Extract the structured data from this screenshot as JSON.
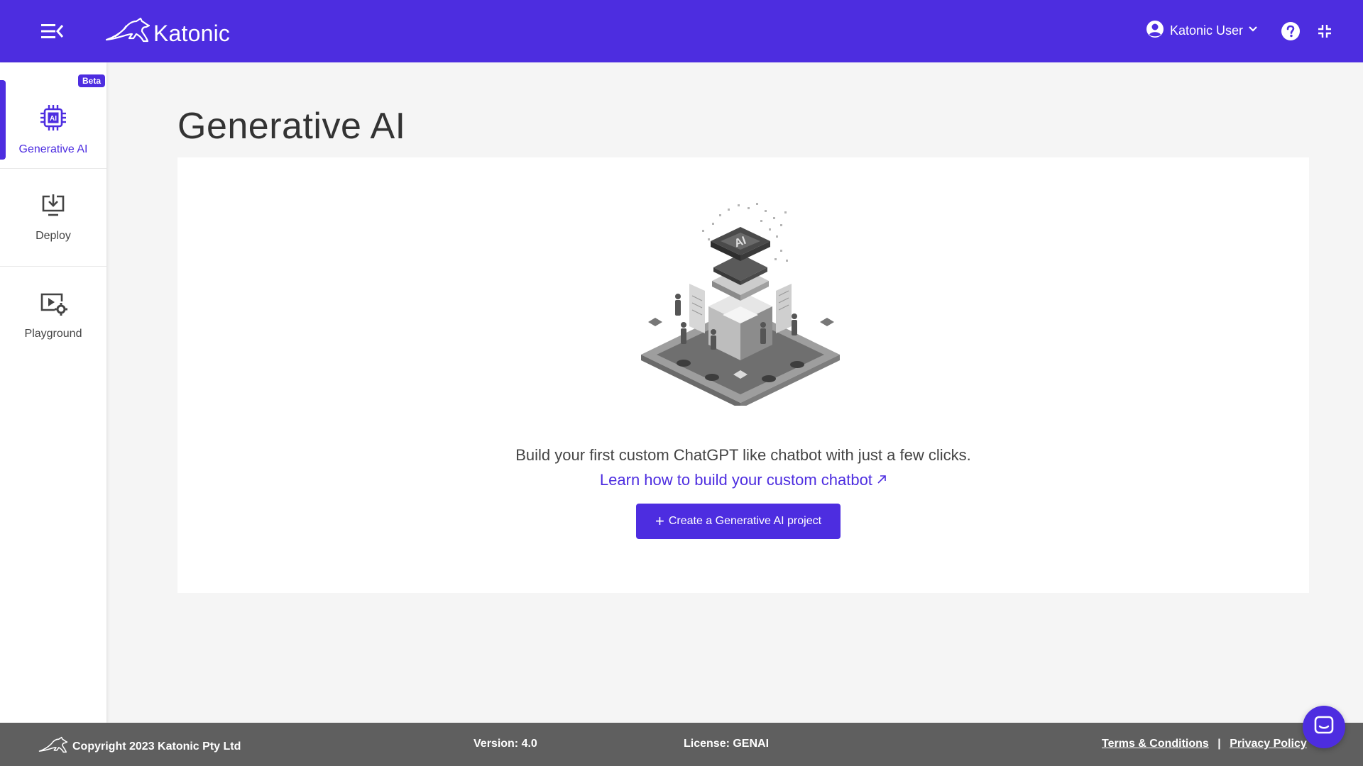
{
  "header": {
    "brand": "Katonic",
    "user_name": "Katonic User",
    "accent_color": "#4d2de0"
  },
  "icons": {
    "menu": "menu-collapse-icon",
    "logo": "kangaroo-logo-icon",
    "user": "user-circle-icon",
    "chevron": "chevron-down-icon",
    "help": "help-circle-icon",
    "collapse": "collapse-arrows-icon",
    "chat": "chat-bubble-icon",
    "external": "external-link-icon"
  },
  "sidebar": {
    "items": [
      {
        "label": "Generative AI",
        "icon": "ai-chip-icon",
        "badge": "Beta",
        "active": true
      },
      {
        "label": "Deploy",
        "icon": "monitor-download-icon",
        "active": false
      },
      {
        "label": "Playground",
        "icon": "video-settings-icon",
        "active": false
      }
    ]
  },
  "main": {
    "title": "Generative AI",
    "intro": "Build your first custom ChatGPT like chatbot with just a few clicks.",
    "learn_link": "Learn how to build your custom chatbot",
    "cta_label": "Create a Generative AI project",
    "illustration_text": "AI"
  },
  "footer": {
    "copyright": "Copyright 2023 Katonic Pty Ltd",
    "version": "Version: 4.0",
    "license": "License: GENAI",
    "terms": "Terms & Conditions",
    "separator": "|",
    "privacy": "Privacy Policy"
  }
}
